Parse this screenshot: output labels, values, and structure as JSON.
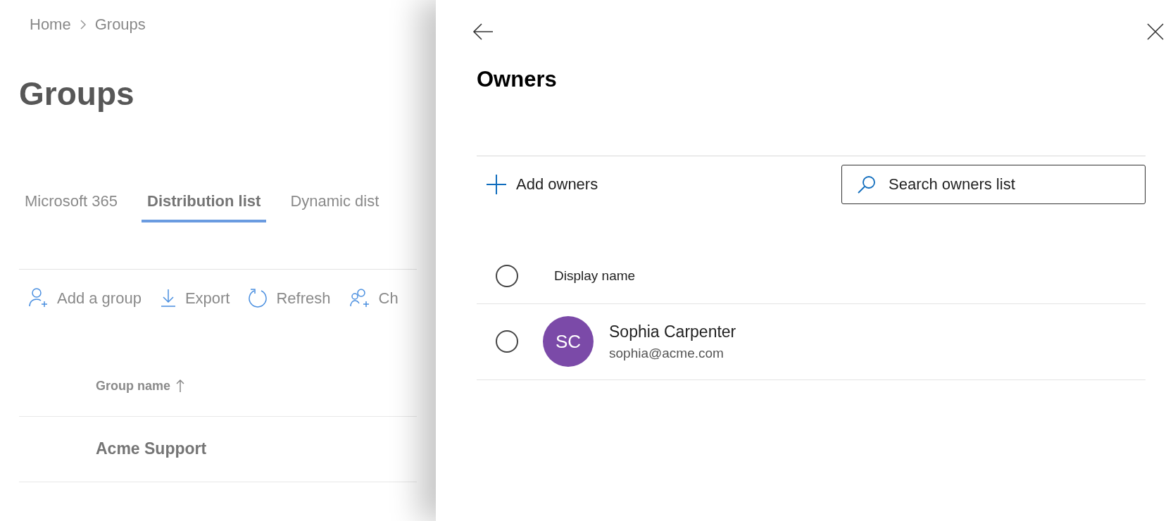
{
  "breadcrumb": [
    "Home",
    "Groups"
  ],
  "page_title": "Groups",
  "tabs": [
    {
      "label": "Microsoft 365",
      "selected": false
    },
    {
      "label": "Distribution list",
      "selected": true
    },
    {
      "label": "Dynamic dist",
      "selected": false
    }
  ],
  "toolbar": [
    {
      "kind": "add-person",
      "label": "Add a group"
    },
    {
      "kind": "download",
      "label": "Export"
    },
    {
      "kind": "refresh",
      "label": "Refresh"
    },
    {
      "kind": "people",
      "label": "Ch"
    }
  ],
  "table": {
    "columns": [
      {
        "label": "Group name",
        "sort_ascending": true
      }
    ],
    "rows": [
      {
        "name": "Acme Support"
      }
    ]
  },
  "panel": {
    "title": "Owners",
    "add_button": "Add owners",
    "search": {
      "placeholder": "Search owners list"
    },
    "list_header": {
      "label": "Display name",
      "selected": false
    },
    "owners": [
      {
        "initials": "SC",
        "name": "Sophia Carpenter",
        "email": "sophia@acme.com",
        "color": "#7b4aa8",
        "selected": false
      }
    ]
  }
}
